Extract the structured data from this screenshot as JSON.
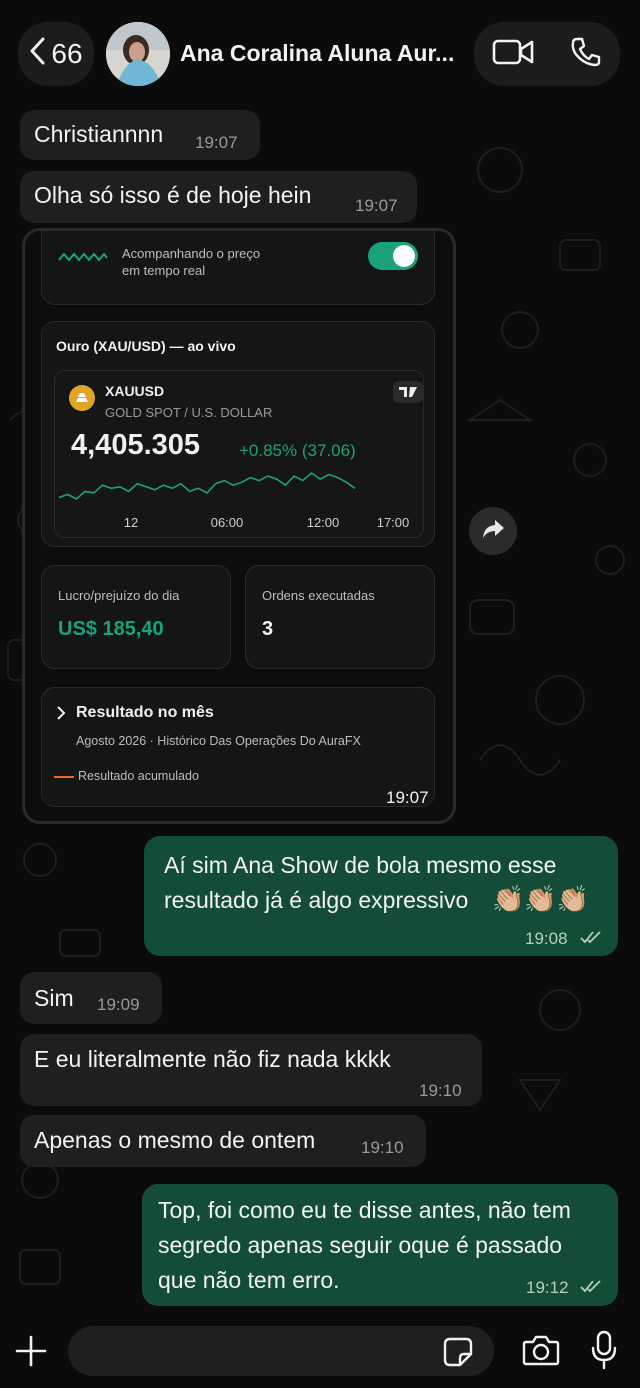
{
  "header": {
    "back_count": "66",
    "contact_name": "Ana Coralina Aluna Aur..."
  },
  "messages": {
    "m1": {
      "text": "Christiannnn",
      "time": "19:07"
    },
    "m2": {
      "text": "Olha só isso é de hoje hein",
      "time": "19:07"
    },
    "image_card": {
      "tracking_text_1": "Acompanhando o preço",
      "tracking_text_2": "em tempo real",
      "chart_title": "Ouro (XAU/USD) — ao vivo",
      "symbol": "XAUUSD",
      "symbol_desc": "GOLD SPOT / U.S. DOLLAR",
      "price": "4,405.305",
      "change": "+0.85% (37.06)",
      "profit_label": "Lucro/prejuízo do dia",
      "profit_value": "US$ 185,40",
      "orders_label": "Ordens executadas",
      "orders_value": "3",
      "result_title": "Resultado no mês",
      "result_sub": "Agosto 2026 · Histórico Das Operações Do AuraFX",
      "result_legend": "Resultado acumulado",
      "time": "19:07"
    },
    "m3": {
      "line1": "Aí sim Ana  Show de bola mesmo esse",
      "line2": "resultado já é algo expressivo",
      "emoji": "👏🏼👏🏼👏🏼",
      "time": "19:08"
    },
    "m4": {
      "text": "Sim",
      "time": "19:09"
    },
    "m5": {
      "text": "E eu literalmente não fiz nada kkkk",
      "time": "19:10"
    },
    "m6": {
      "text": "Apenas o mesmo de ontem",
      "time": "19:10"
    },
    "m7": {
      "line1": "Top, foi como eu te disse antes, não tem",
      "line2": "segredo apenas seguir oque é passado",
      "line3": "que não tem erro.",
      "time": "19:12"
    }
  },
  "colors": {
    "accent_green": "#1aa37a",
    "outgoing_bubble": "#144d37",
    "incoming_bubble": "#1f1f1f"
  },
  "chart_data": {
    "type": "line",
    "title": "",
    "x_ticks": [
      "12",
      "06:00",
      "12:00",
      "17:00"
    ],
    "y": [
      4390,
      4392,
      4389,
      4394,
      4393,
      4398,
      4396,
      4397,
      4394,
      4399,
      4397,
      4395,
      4398,
      4396,
      4399,
      4394,
      4396,
      4393,
      4399,
      4401,
      4398,
      4400,
      4403,
      4401,
      4404,
      4402,
      4398,
      4404,
      4401,
      4406,
      4402,
      4405,
      4403,
      4400,
      4396
    ],
    "color": "#1aa37a"
  }
}
